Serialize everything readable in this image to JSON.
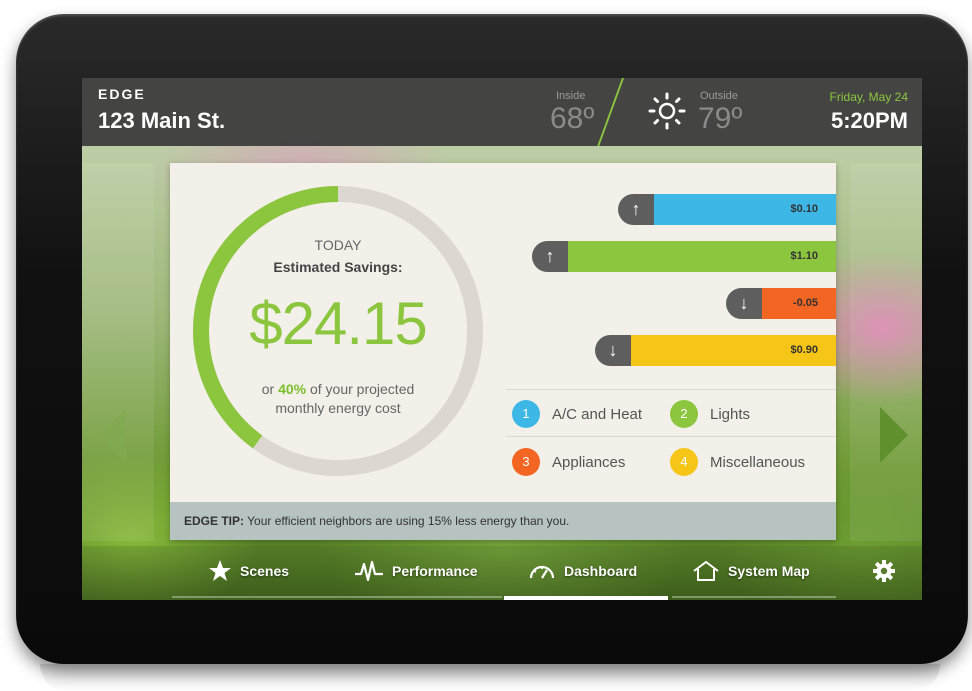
{
  "header": {
    "logo": "EDGE",
    "address": "123 Main St.",
    "inside_label": "Inside",
    "inside_temp": "68º",
    "outside_label": "Outside",
    "outside_temp": "79º",
    "date": "Friday, May 24",
    "time": "5:20PM"
  },
  "savings": {
    "today_label": "TODAY",
    "estimated_label": "Estimated Savings:",
    "amount": "$24.15",
    "projected_prefix": "or",
    "projected_percent": "40%",
    "projected_suffix": "of your projected",
    "projected_line2": "monthly energy cost",
    "progress_fraction": 0.4
  },
  "bars": [
    {
      "direction": "up",
      "arrow": "↑",
      "value": "$0.10",
      "color": "#3db8e6",
      "category": 1
    },
    {
      "direction": "up",
      "arrow": "↑",
      "value": "$1.10",
      "color": "#8cc63f",
      "category": 2
    },
    {
      "direction": "down",
      "arrow": "↓",
      "value": "-0.05",
      "color": "#f26522",
      "category": 3
    },
    {
      "direction": "down",
      "arrow": "↓",
      "value": "$0.90",
      "color": "#f5c518",
      "category": 4
    }
  ],
  "legend": [
    {
      "number": "1",
      "label": "A/C and Heat",
      "color": "#3db8e6"
    },
    {
      "number": "2",
      "label": "Lights",
      "color": "#8cc63f"
    },
    {
      "number": "3",
      "label": "Appliances",
      "color": "#f26522"
    },
    {
      "number": "4",
      "label": "Miscellaneous",
      "color": "#f5c518"
    }
  ],
  "tip": {
    "label": "EDGE TIP:",
    "text": "Your efficient neighbors are using 15% less energy than you."
  },
  "nav": {
    "scenes": "Scenes",
    "performance": "Performance",
    "dashboard": "Dashboard",
    "system_map": "System Map",
    "active": "dashboard"
  },
  "colors": {
    "accent_green": "#8cc63f",
    "ring_track": "#dcd8d1",
    "header_bg": "#3e3e3e"
  }
}
